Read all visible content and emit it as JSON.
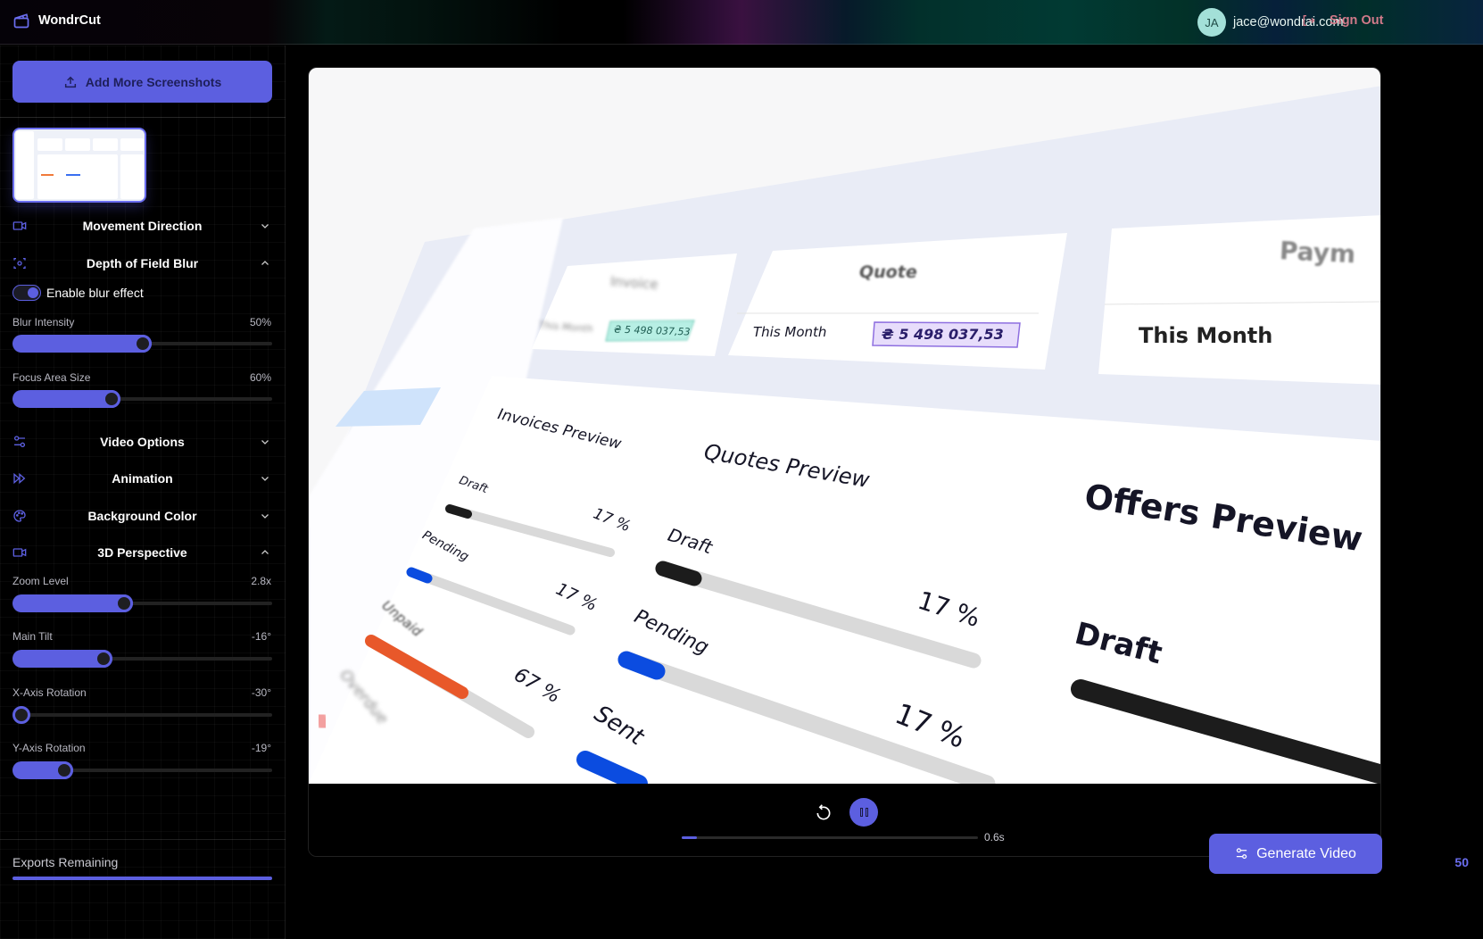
{
  "app": {
    "name": "WondrCut"
  },
  "header": {
    "user_initials": "JA",
    "user_email": "jace@wondrai.com",
    "sign_out": "Sign Out"
  },
  "sidebar": {
    "add_button": "Add More Screenshots",
    "sections": [
      {
        "title": "Movement Direction",
        "icon": "video-camera-icon",
        "expanded": false
      },
      {
        "title": "Depth of Field Blur",
        "icon": "focus-icon",
        "expanded": true
      },
      {
        "title": "Video Options",
        "icon": "sliders-icon",
        "expanded": false
      },
      {
        "title": "Animation",
        "icon": "fast-forward-icon",
        "expanded": false
      },
      {
        "title": "Background Color",
        "icon": "palette-icon",
        "expanded": false
      },
      {
        "title": "3D Perspective",
        "icon": "video-camera-icon",
        "expanded": true
      }
    ],
    "blur": {
      "toggle_label": "Enable blur effect",
      "toggle_on": true,
      "intensity": {
        "label": "Blur Intensity",
        "value": "50%",
        "fraction": 0.5
      },
      "focus": {
        "label": "Focus Area Size",
        "value": "60%",
        "fraction": 0.38
      }
    },
    "perspective": {
      "zoom": {
        "label": "Zoom Level",
        "value": "2.8x",
        "fraction": 0.43
      },
      "tilt": {
        "label": "Main Tilt",
        "value": "-16°",
        "fraction": 0.35
      },
      "xrot": {
        "label": "X-Axis Rotation",
        "value": "-30°",
        "fraction": 0.0
      },
      "yrot": {
        "label": "Y-Axis Rotation",
        "value": "-19°",
        "fraction": 0.2
      }
    },
    "exports": {
      "label": "Exports Remaining",
      "value": "50",
      "fraction": 1.0
    }
  },
  "preview": {
    "cards": [
      {
        "title": "Invoice",
        "period": "This Month",
        "amount": "₴ 5 498 037,53"
      },
      {
        "title": "Quote",
        "period": "This Month",
        "amount": "₴ 5 498 037,53"
      },
      {
        "title": "Paym",
        "period": "This Month",
        "amount": ""
      }
    ],
    "invoices": {
      "title": "Invoices Preview",
      "rows": [
        {
          "label": "Draft",
          "pct": "17 %"
        },
        {
          "label": "Pending",
          "pct": "17 %"
        },
        {
          "label": "Unpaid",
          "pct": "67 %"
        },
        {
          "label": "Overdue",
          "pct": ""
        }
      ]
    },
    "quotes": {
      "title": "Quotes Preview",
      "rows": [
        {
          "label": "Draft",
          "pct": "17 %"
        },
        {
          "label": "Pending",
          "pct": "17 %"
        },
        {
          "label": "Sent",
          "pct": ""
        }
      ]
    },
    "offers": {
      "title": "Offers Preview",
      "rows": [
        {
          "label": "Draft",
          "pct": ""
        }
      ]
    }
  },
  "playback": {
    "time": "0.6s",
    "progress": 0.05
  },
  "generate_button": "Generate Video",
  "colors": {
    "accent": "#5c5fe0",
    "signout": "#d27a8a"
  }
}
